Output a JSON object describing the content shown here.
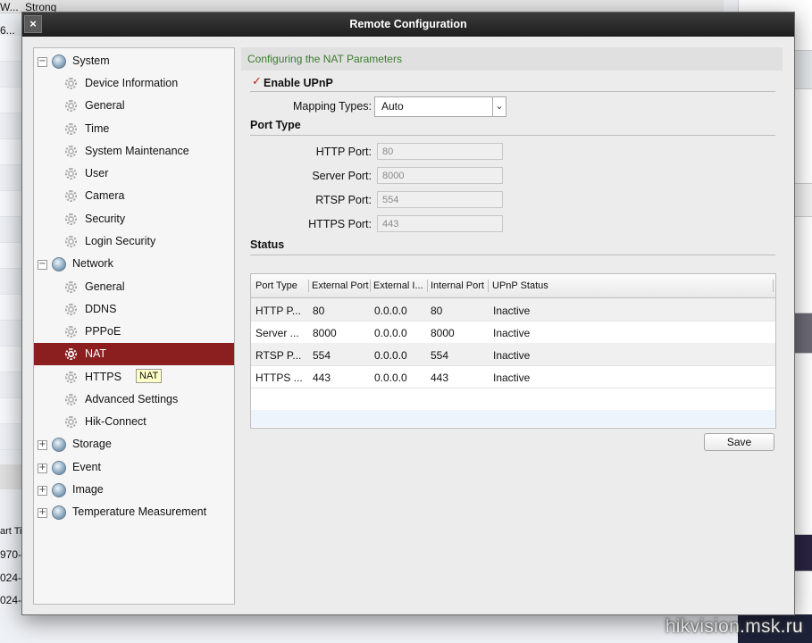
{
  "background": {
    "top_cells": [
      "W...",
      "Strong"
    ],
    "left_cells": [
      "6...",
      "art Ti",
      "970-",
      "024-",
      "024-"
    ],
    "watermark": "hikvision.msk.ru"
  },
  "dialog": {
    "title": "Remote Configuration",
    "close_glyph": "×",
    "tree": {
      "groups": [
        {
          "label": "System",
          "expander": "−",
          "children": [
            "Device Information",
            "General",
            "Time",
            "System Maintenance",
            "User",
            "Camera",
            "Security",
            "Login Security"
          ]
        },
        {
          "label": "Network",
          "expander": "−",
          "children": [
            "General",
            "DDNS",
            "PPPoE",
            "NAT",
            "HTTPS",
            "Advanced Settings",
            "Hik-Connect"
          ]
        },
        {
          "label": "Storage",
          "expander": "+"
        },
        {
          "label": "Event",
          "expander": "+"
        },
        {
          "label": "Image",
          "expander": "+"
        },
        {
          "label": "Temperature Measurement",
          "expander": "+"
        }
      ],
      "selected": "NAT",
      "tooltip": "NAT"
    },
    "content": {
      "section_title": "Configuring the NAT Parameters",
      "enable_upnp": {
        "label": "Enable UPnP",
        "checked": true,
        "check_glyph": "✓"
      },
      "mapping_types": {
        "label": "Mapping Types:",
        "value": "Auto",
        "arrow": "⌄"
      },
      "port_type_title": "Port Type",
      "ports": [
        {
          "label": "HTTP Port:",
          "value": "80"
        },
        {
          "label": "Server Port:",
          "value": "8000"
        },
        {
          "label": "RTSP Port:",
          "value": "554"
        },
        {
          "label": "HTTPS Port:",
          "value": "443"
        }
      ],
      "status_title": "Status",
      "table": {
        "columns": [
          "Port Type",
          "External Port",
          "External I...",
          "Internal Port",
          "UPnP Status"
        ],
        "rows": [
          [
            "HTTP P...",
            "80",
            "0.0.0.0",
            "80",
            "Inactive"
          ],
          [
            "Server ...",
            "8000",
            "0.0.0.0",
            "8000",
            "Inactive"
          ],
          [
            "RTSP P...",
            "554",
            "0.0.0.0",
            "554",
            "Inactive"
          ],
          [
            "HTTPS ...",
            "443",
            "0.0.0.0",
            "443",
            "Inactive"
          ]
        ]
      },
      "save_label": "Save"
    }
  },
  "colors": {
    "selected_row": "#8b1f1f",
    "section_title": "#3a7b2e",
    "check": "#c01c1c"
  }
}
